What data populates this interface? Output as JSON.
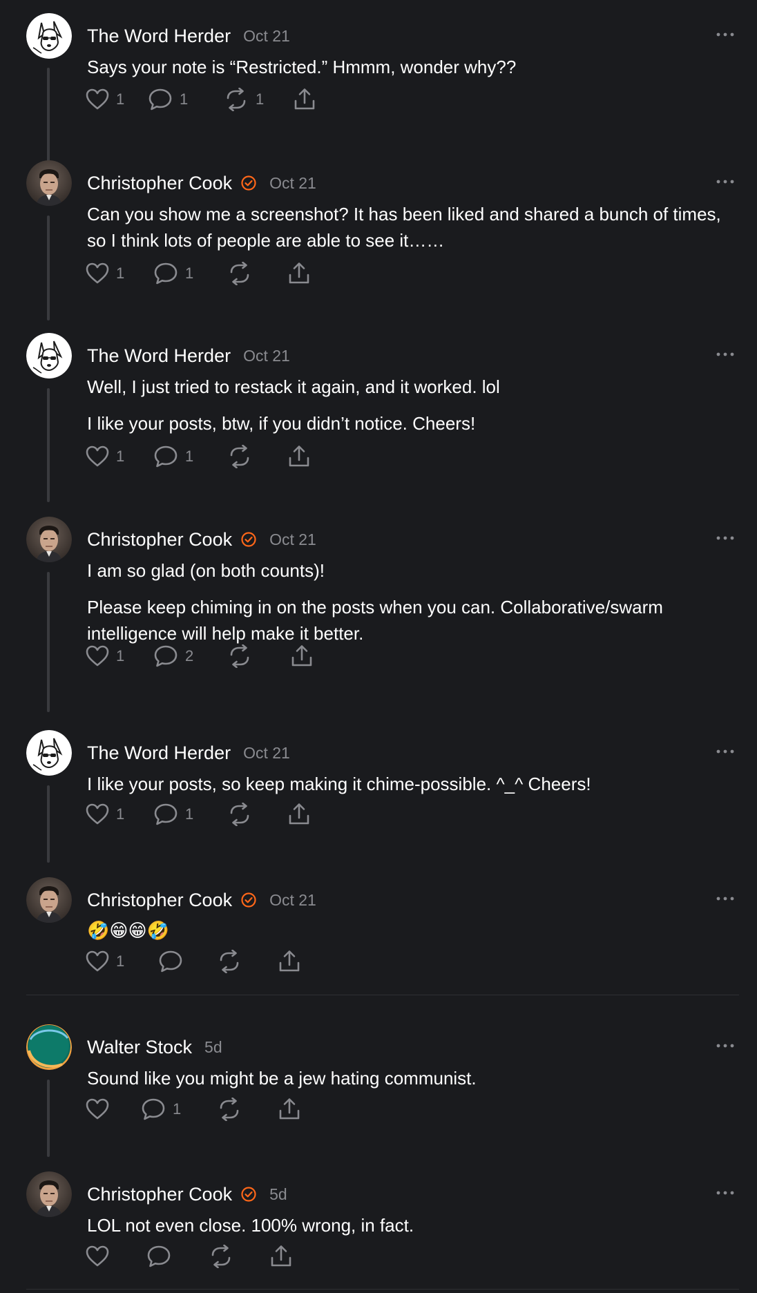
{
  "comments": [
    {
      "author": "The Word Herder",
      "date": "Oct 21",
      "avatar_icon": "dog-avatar-icon",
      "verified": false,
      "paragraphs": [
        "Says your note is “Restricted.” Hmmm, wonder why??"
      ],
      "likes": "1",
      "replies": "1",
      "restacks": "1"
    },
    {
      "author": "Christopher Cook",
      "date": "Oct 21",
      "avatar_icon": "man-portrait-avatar-icon",
      "verified": true,
      "paragraphs": [
        "Can you show me a screenshot? It has been liked and shared a bunch of times, so I think lots of people are able to see it……"
      ],
      "likes": "1",
      "replies": "1",
      "restacks": ""
    },
    {
      "author": "The Word Herder",
      "date": "Oct 21",
      "avatar_icon": "dog-avatar-icon",
      "verified": false,
      "paragraphs": [
        "Well, I just tried to restack it again, and it worked. lol",
        "I like your posts, btw, if you didn’t notice. Cheers!"
      ],
      "likes": "1",
      "replies": "1",
      "restacks": ""
    },
    {
      "author": "Christopher Cook",
      "date": "Oct 21",
      "avatar_icon": "man-portrait-avatar-icon",
      "verified": true,
      "paragraphs": [
        "I am so glad (on both counts)!",
        "Please keep chiming in on the posts when you can. Collaborative/swarm intelligence will help make it better."
      ],
      "likes": "1",
      "replies": "2",
      "restacks": ""
    },
    {
      "author": "The Word Herder",
      "date": "Oct 21",
      "avatar_icon": "dog-avatar-icon",
      "verified": false,
      "paragraphs": [
        "I like your posts, so keep making it chime-possible. ^_^ Cheers!"
      ],
      "likes": "1",
      "replies": "1",
      "restacks": ""
    },
    {
      "author": "Christopher Cook",
      "date": "Oct 21",
      "avatar_icon": "man-portrait-avatar-icon",
      "verified": true,
      "paragraphs": [
        "🤣😁😁🤣"
      ],
      "likes": "1",
      "replies": "",
      "restacks": ""
    },
    {
      "author": "Walter Stock",
      "date": "5d",
      "avatar_icon": "green-orb-avatar-icon",
      "verified": false,
      "paragraphs": [
        "Sound like you might be a jew hating communist."
      ],
      "likes": "",
      "replies": "1",
      "restacks": ""
    },
    {
      "author": "Christopher Cook",
      "date": "5d",
      "avatar_icon": "man-portrait-avatar-icon",
      "verified": true,
      "paragraphs": [
        "LOL not even close. 100% wrong, in fact."
      ],
      "likes": "",
      "replies": "",
      "restacks": ""
    }
  ],
  "icons": {
    "like": "heart-icon",
    "reply": "speech-bubble-icon",
    "restack": "restack-arrows-icon",
    "share": "share-upload-icon",
    "more": "more-dots-icon",
    "verified": "verified-check-icon"
  },
  "colors": {
    "background": "#1a1b1e",
    "text_primary": "#ffffff",
    "text_secondary": "#8a8b90",
    "verified_accent": "#ff6719",
    "thread_line": "#3a3b3f"
  }
}
